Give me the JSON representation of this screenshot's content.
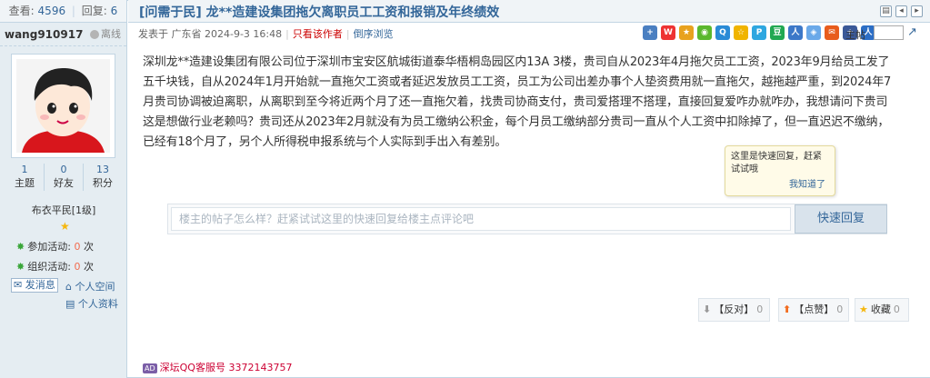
{
  "stats": {
    "views_label": "查看:",
    "views": "4596",
    "replies_label": "回复:",
    "replies": "6"
  },
  "user": {
    "name": "wang910917",
    "status": "离线",
    "threads_value": "1",
    "threads_label": "主题",
    "friends_value": "0",
    "friends_label": "好友",
    "points_value": "13",
    "points_label": "积分",
    "rank": "布衣平民[1级]",
    "activity_join_label": "参加活动:",
    "activity_join": "0",
    "activity_unit": "次",
    "activity_org_label": "组织活动:",
    "activity_org": "0",
    "message_btn": "发消息",
    "space_link": "个人空间",
    "profile_link": "个人资料"
  },
  "post": {
    "title": "[问需于民] 龙**造建设集团拖欠离职员工工资和报销及年终绩效",
    "meta_posted": "发表于 广东省 2024-9-3 16:48",
    "meta_author_only": "只看该作者",
    "meta_reverse": "倒序浏览",
    "floor_label": "主帖",
    "content": "深圳龙**造建设集团有限公司位于深圳市宝安区航城街道泰华梧桐岛园区内13A 3楼，贵司自从2023年4月拖欠员工工资，2023年9月给员工发了五千块钱，自从2024年1月开始就一直拖欠工资或者延迟发放员工工资，员工为公司出差办事个人垫资费用就一直拖欠，越拖越严重，到2024年7月贵司协调被迫离职，从离职到至今将近两个月了还一直拖欠着，找贵司协商支付，贵司爱搭理不搭理，直接回复爱咋办就咋办，我想请问下贵司这是想做行业老赖吗？贵司还从2023年2月就没有为员工缴纳公积金，每个月员工缴纳部分贵司一直从个人工资中扣除掉了，但一直迟迟不缴纳，已经有18个月了，另个人所得税申报系统与个人实际到手出入有差别。"
  },
  "tip": {
    "text": "这里是快速回复，赶紧试试哦",
    "ok": "我知道了"
  },
  "quick_reply": {
    "placeholder": "楼主的帖子怎么样？赶紧试试这里的快速回复给楼主点评论吧",
    "button": "快速回复"
  },
  "actions": {
    "oppose": "【反对】",
    "oppose_count": "0",
    "like": "【点赞】",
    "like_count": "0",
    "favorite": "收藏",
    "favorite_count": "0"
  },
  "ad": {
    "badge": "AD",
    "text": "深坛QQ客服号 3372143757"
  },
  "colors": {
    "link": "#336699",
    "accent_red": "#cc0000",
    "border": "#c2d5e3",
    "side_bg": "#e5edf2"
  },
  "icons": [
    "print-icon",
    "prev-icon",
    "next-icon",
    "share-icons",
    "star-icon",
    "activity-icon",
    "message-icon",
    "home-icon",
    "profile-icon"
  ]
}
